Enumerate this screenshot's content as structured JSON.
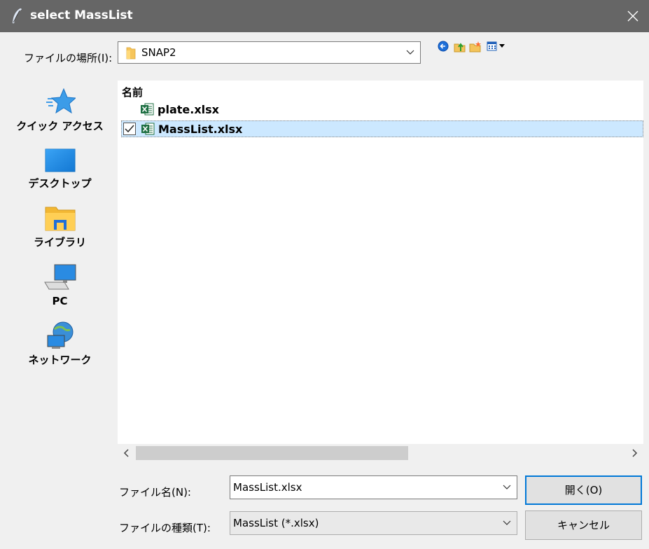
{
  "window": {
    "title": "select MassList",
    "icon": "feather-icon"
  },
  "lookin": {
    "label": "ファイルの場所(I):",
    "value": "SNAP2"
  },
  "toolbar": [
    "back-icon",
    "up-folder-icon",
    "new-folder-icon",
    "view-menu-icon"
  ],
  "places": [
    {
      "label": "クイック アクセス",
      "icon": "star-icon"
    },
    {
      "label": "デスクトップ",
      "icon": "desktop-icon"
    },
    {
      "label": "ライブラリ",
      "icon": "library-folder-icon"
    },
    {
      "label": "PC",
      "icon": "computer-icon"
    },
    {
      "label": "ネットワーク",
      "icon": "network-icon"
    }
  ],
  "filelist": {
    "column_header": "名前",
    "files": [
      {
        "name": "plate.xlsx",
        "selected": false
      },
      {
        "name": "MassList.xlsx",
        "selected": true
      }
    ]
  },
  "filename": {
    "label": "ファイル名(N):",
    "value": "MassList.xlsx"
  },
  "filetype": {
    "label": "ファイルの種類(T):",
    "value": "MassList (*.xlsx)"
  },
  "buttons": {
    "open": "開く(O)",
    "cancel": "キャンセル"
  },
  "colors": {
    "titlebar": "#666666",
    "selection": "#cce8ff",
    "accent": "#0078d7",
    "excel_green": "#1d6f42"
  }
}
